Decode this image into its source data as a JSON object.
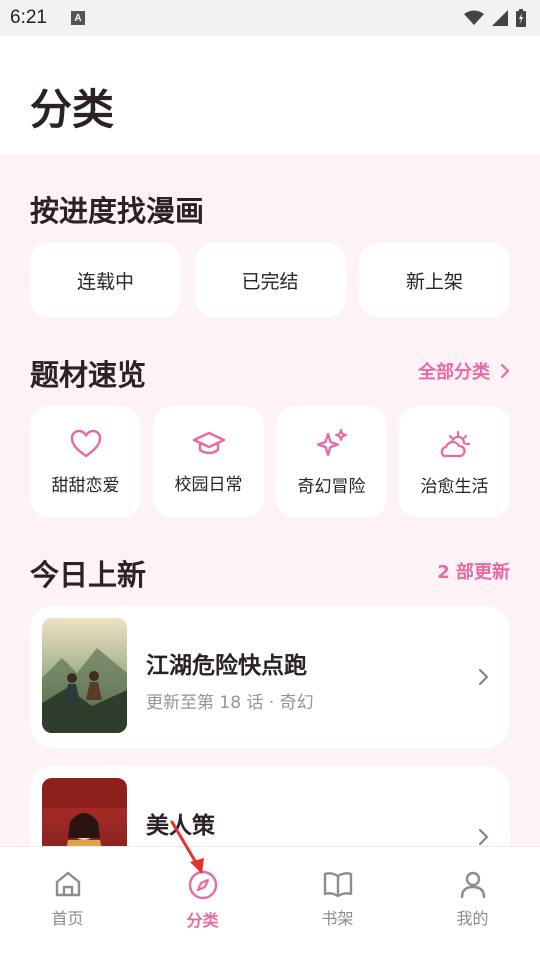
{
  "status_bar": {
    "time": "6:21",
    "notification_glyph": "A"
  },
  "header": {
    "title": "分类"
  },
  "progress_section": {
    "title": "按进度找漫画",
    "items": [
      {
        "label": "连载中"
      },
      {
        "label": "已完结"
      },
      {
        "label": "新上架"
      }
    ]
  },
  "genre_section": {
    "title": "题材速览",
    "link_label": "全部分类",
    "items": [
      {
        "label": "甜甜恋爱",
        "icon": "heart-icon"
      },
      {
        "label": "校园日常",
        "icon": "graduation-cap-icon"
      },
      {
        "label": "奇幻冒险",
        "icon": "sparkles-icon"
      },
      {
        "label": "治愈生活",
        "icon": "sun-cloud-icon"
      }
    ]
  },
  "new_section": {
    "title": "今日上新",
    "update_count": "2 部更新",
    "items": [
      {
        "title": "江湖危险快点跑",
        "subtitle": "更新至第 18 话 · 奇幻",
        "cover_text": "江湖危险快点跑"
      },
      {
        "title": "美人策",
        "subtitle": "",
        "cover_text": "美人策"
      }
    ]
  },
  "bottom_nav": {
    "items": [
      {
        "label": "首页",
        "icon": "home-icon",
        "active": false
      },
      {
        "label": "分类",
        "icon": "compass-icon",
        "active": true
      },
      {
        "label": "书架",
        "icon": "book-icon",
        "active": false
      },
      {
        "label": "我的",
        "icon": "user-icon",
        "active": false
      }
    ]
  },
  "colors": {
    "accent": "#e96aa1",
    "background": "#fdf3f6",
    "card": "#ffffff",
    "text": "#2a2226",
    "muted": "#9a9295"
  }
}
